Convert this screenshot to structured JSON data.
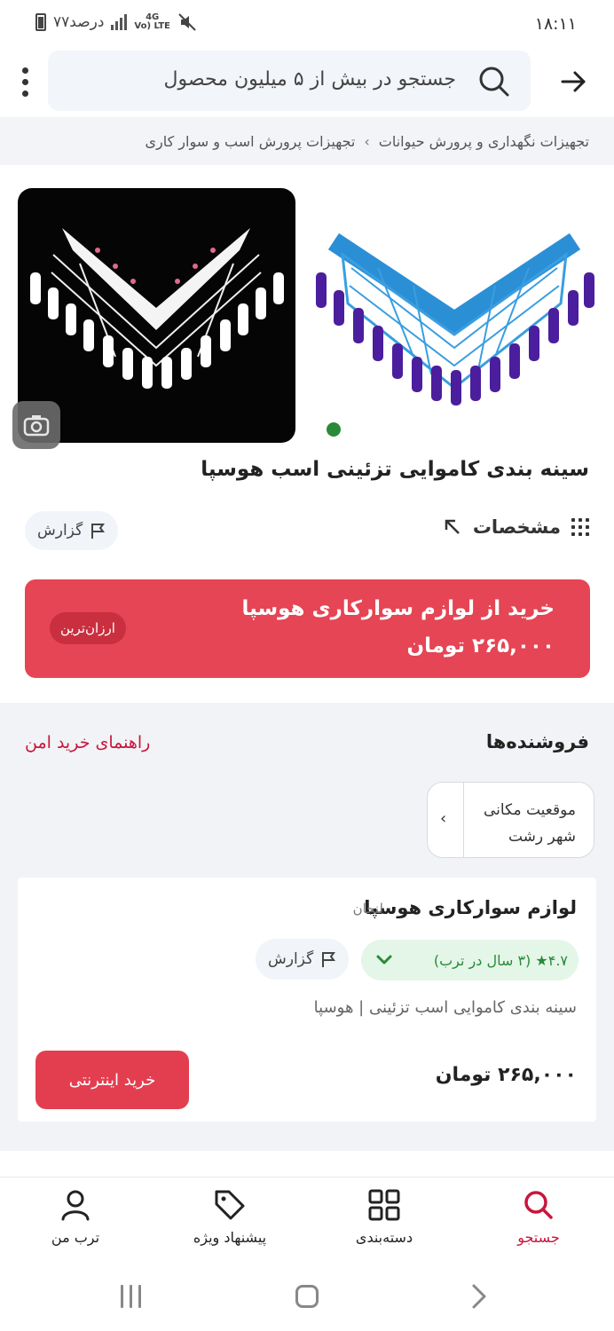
{
  "status_bar": {
    "time": "۱۸:۱۱",
    "battery_text": "۷۷درصد",
    "network_top": "4G",
    "network_bottom": "Vo) LTE"
  },
  "header": {
    "search_placeholder": "جستجو در بیش از ۵ میلیون محصول"
  },
  "breadcrumb": {
    "items": [
      "تجهیزات نگهداری و پرورش حیوانات",
      "تجهیزات پرورش اسب و سوار کاری"
    ],
    "separator": "›"
  },
  "product": {
    "title": "سینه بندی کاموایی تزئینی اسب هوسپا",
    "specs_label": "مشخصات",
    "report_label": "گزارش"
  },
  "buy_banner": {
    "title": "خرید از لوازم سوارکاری هوسپا",
    "price": "۲۶۵,۰۰۰ تومان",
    "badge": "ارزان‌ترین"
  },
  "sellers": {
    "heading": "فروشنده‌ها",
    "guide_link": "راهنمای خرید امن",
    "location": {
      "label": "موقعیت مکانی",
      "value": "شهر رشت",
      "chevron": "‹"
    },
    "card": {
      "name": "لوازم سوارکاری هوسپا",
      "city": "لنجان",
      "rating": "۴.۷★ (۳ سال در ترب)",
      "report_label": "گزارش",
      "description": "سینه بندی کاموایی اسب تزئینی | هوسپا",
      "price": "۲۶۵,۰۰۰ تومان",
      "buy_button": "خرید اینترنتی"
    }
  },
  "bottom_nav": {
    "items": [
      {
        "label": "جستجو",
        "icon": "search-icon",
        "active": true
      },
      {
        "label": "دسته‌بندی",
        "icon": "grid-icon",
        "active": false
      },
      {
        "label": "پیشنهاد ویژه",
        "icon": "tag-icon",
        "active": false
      },
      {
        "label": "ترب من",
        "icon": "user-icon",
        "active": false
      }
    ]
  },
  "colors": {
    "accent_red": "#e54554",
    "brand_pink": "#c8163c",
    "rating_green": "#2a8a3a"
  }
}
